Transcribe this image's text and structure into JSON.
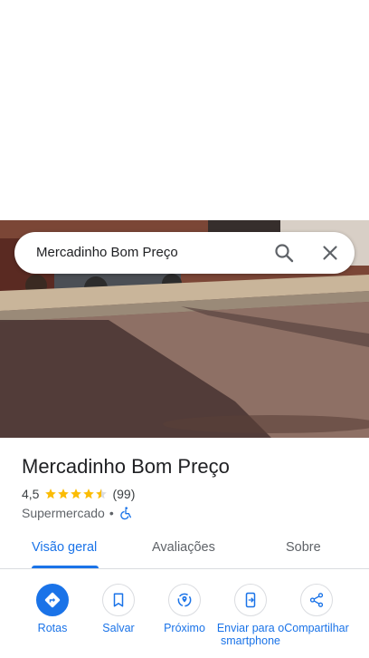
{
  "search": {
    "query": "Mercadinho Bom Preço"
  },
  "place": {
    "title": "Mercadinho Bom Preço",
    "rating": "4,5",
    "stars": 4.5,
    "reviews": "(99)",
    "category": "Supermercado",
    "separator": "•"
  },
  "tabs": [
    {
      "label": "Visão geral",
      "active": true
    },
    {
      "label": "Avaliações",
      "active": false
    },
    {
      "label": "Sobre",
      "active": false
    }
  ],
  "actions": [
    {
      "label": "Rotas",
      "icon": "directions-icon"
    },
    {
      "label": "Salvar",
      "icon": "bookmark-icon"
    },
    {
      "label": "Próximo",
      "icon": "nearby-icon"
    },
    {
      "label": "Enviar para o smartphone",
      "icon": "send-to-phone-icon"
    },
    {
      "label": "Compartilhar",
      "icon": "share-icon"
    }
  ],
  "colors": {
    "accent": "#1a73e8",
    "star": "#fbbc04",
    "text": "#202124",
    "muted": "#5f6368"
  }
}
